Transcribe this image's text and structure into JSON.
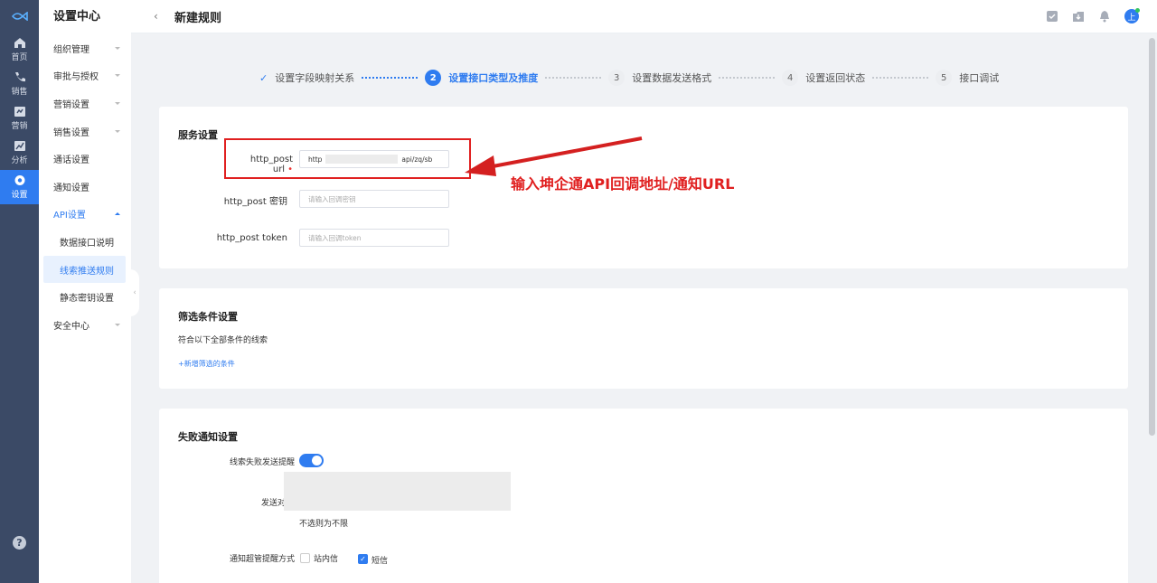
{
  "rail": {
    "items": [
      {
        "label": "首页",
        "icon": "home-icon"
      },
      {
        "label": "销售",
        "icon": "phone-icon"
      },
      {
        "label": "营销",
        "icon": "marketing-icon"
      },
      {
        "label": "分析",
        "icon": "chart-icon"
      },
      {
        "label": "设置",
        "icon": "gear-icon"
      }
    ],
    "help": "?"
  },
  "menu": {
    "title": "设置中心",
    "items": [
      "组织管理",
      "审批与授权",
      "营销设置",
      "销售设置",
      "通话设置",
      "通知设置",
      "API设置"
    ],
    "subitems": [
      "数据接口说明",
      "线索推送规则",
      "静态密钥设置"
    ],
    "last": "安全中心"
  },
  "header": {
    "back": "‹",
    "title": "新建规则",
    "avatar": "上"
  },
  "steps": [
    {
      "num": "",
      "label": "设置字段映射关系"
    },
    {
      "num": "2",
      "label": "设置接口类型及推度"
    },
    {
      "num": "3",
      "label": "设置数据发送格式"
    },
    {
      "num": "4",
      "label": "设置返回状态"
    },
    {
      "num": "5",
      "label": "接口调试"
    }
  ],
  "service": {
    "title": "服务设置",
    "url_label": "http_post url",
    "url_prefix": "http",
    "url_suffix": "api/zq/sb",
    "secret_label": "http_post 密钥",
    "secret_placeholder": "请输入回调密钥",
    "token_label": "http_post token",
    "token_placeholder": "请输入回调token"
  },
  "annotation": "输入坤企通API回调地址/通知URL",
  "filter": {
    "title": "筛选条件设置",
    "desc": "符合以下全部条件的线索",
    "add": "+新增筛选的条件"
  },
  "failure": {
    "title": "失败通知设置",
    "toggle_label": "线索失败发送提醒",
    "send_label": "发送对",
    "hint": "不选则为不限",
    "method_label": "通知超管提醒方式",
    "opt1": "站内信",
    "opt2": "短信"
  },
  "colors": {
    "accent": "#2f7cf0",
    "annotation": "#e02020",
    "rail": "#3b4a66"
  }
}
